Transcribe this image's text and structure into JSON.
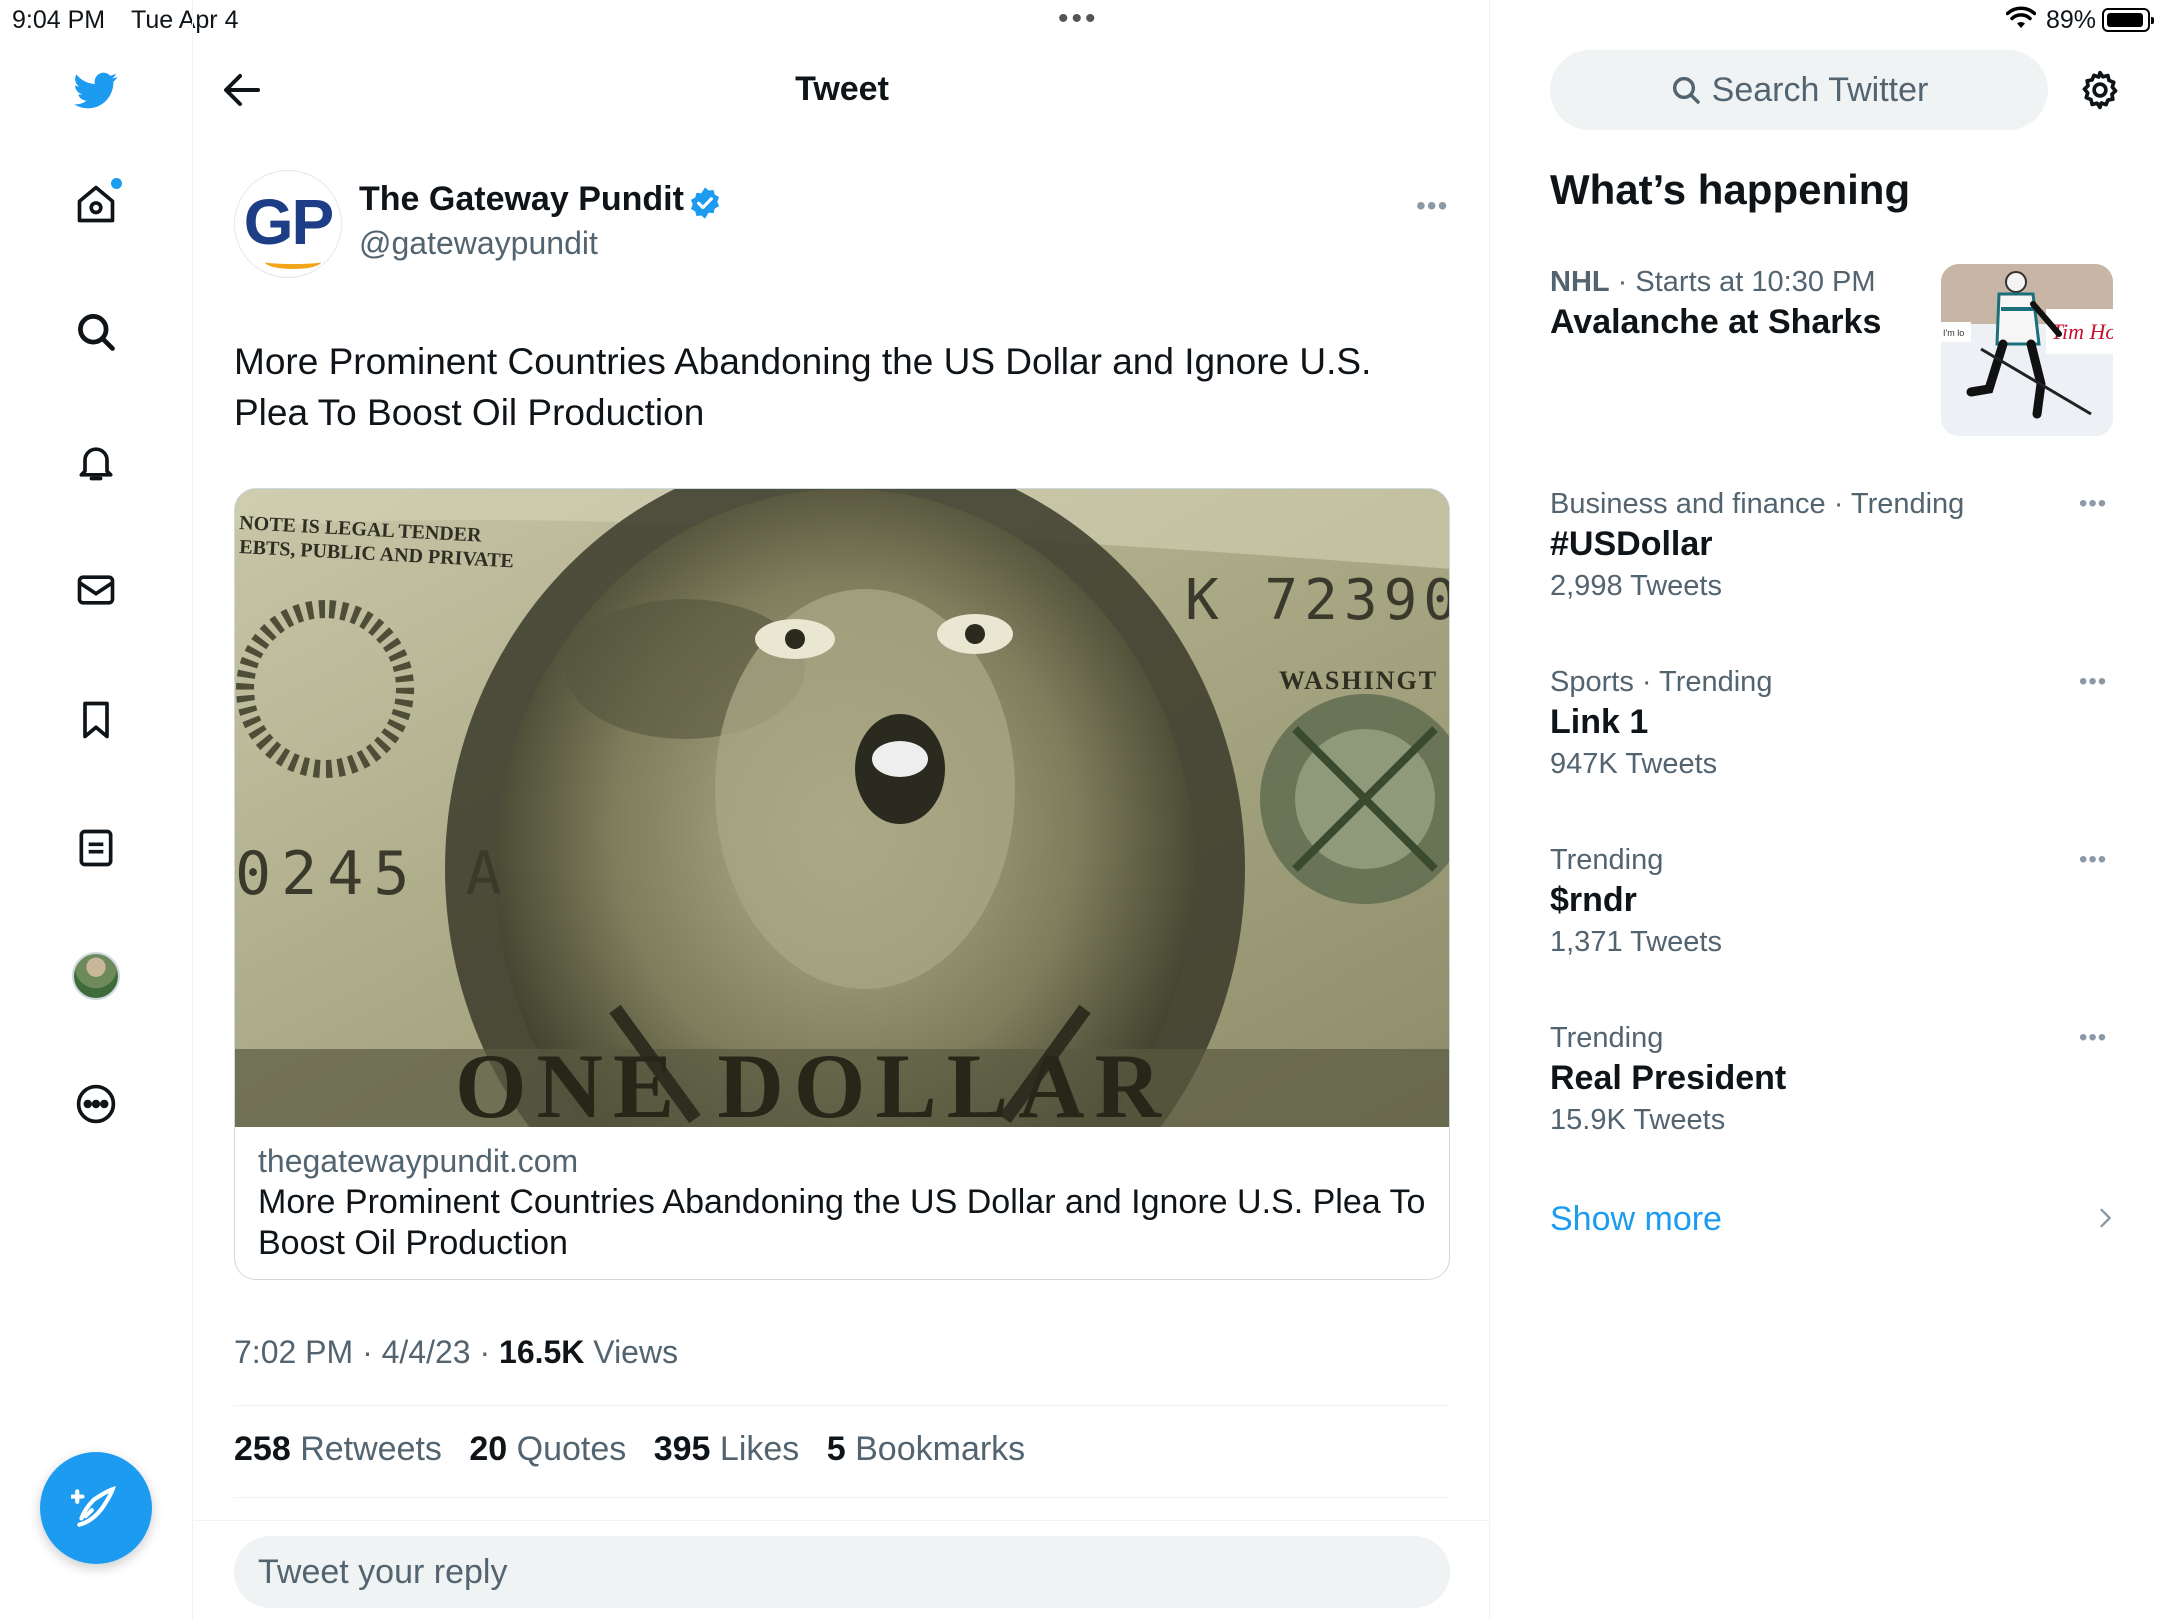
{
  "status_bar": {
    "time": "9:04 PM",
    "date": "Tue Apr 4",
    "battery": "89%",
    "battery_level": 0.89
  },
  "left_nav": {
    "items": [
      {
        "icon": "twitter-bird-icon"
      },
      {
        "icon": "home-icon"
      },
      {
        "icon": "search-icon"
      },
      {
        "icon": "bell-icon"
      },
      {
        "icon": "mail-icon"
      },
      {
        "icon": "bookmark-icon"
      },
      {
        "icon": "list-icon"
      },
      {
        "icon": "avatar"
      },
      {
        "icon": "more-circle-icon"
      }
    ],
    "compose_icon": "compose-feather-icon",
    "accent_color": "#1d9bf0"
  },
  "header": {
    "title": "Tweet"
  },
  "tweet": {
    "author_logo": "GP",
    "author_name": "The Gateway Pundit",
    "handle": "@gatewaypundit",
    "text": "More Prominent Countries Abandoning the US Dollar and Ignore U.S. Plea To Boost Oil Production",
    "card": {
      "domain": "thegatewaypundit.com",
      "title": "More Prominent Countries Abandoning the US Dollar and Ignore U.S. Plea To Boost Oil Production",
      "image_texts": {
        "legal": "NOTE IS LEGAL TENDER",
        "debts": "EBTS, PUBLIC AND PRIVATE",
        "serial_right": "K 72390",
        "serial_left": "0245 A",
        "washington": "WASHINGT",
        "one_dollar": "ONE DOLLAR"
      }
    },
    "time": "7:02 PM",
    "date": "4/4/23",
    "views_count": "16.5K",
    "views_label": "Views",
    "stats": {
      "retweets": "258",
      "retweets_label": "Retweets",
      "quotes": "20",
      "quotes_label": "Quotes",
      "likes": "395",
      "likes_label": "Likes",
      "bookmarks": "5",
      "bookmarks_label": "Bookmarks"
    },
    "reply_placeholder": "Tweet your reply"
  },
  "sidebar": {
    "search_placeholder": "Search Twitter",
    "whats_happening": "What’s happening",
    "trends": [
      {
        "category": "NHL",
        "context": " · Starts at 10:30 PM",
        "name": "Avalanche at Sharks",
        "count": ""
      },
      {
        "category": "Business and finance · Trending",
        "context": "",
        "name": "#USDollar",
        "count": "2,998 Tweets"
      },
      {
        "category": "Sports · Trending",
        "context": "",
        "name": "Link 1",
        "count": "947K Tweets"
      },
      {
        "category": "Trending",
        "context": "",
        "name": "$rndr",
        "count": "1,371 Tweets"
      },
      {
        "category": "Trending",
        "context": "",
        "name": "Real President",
        "count": "15.9K Tweets"
      }
    ],
    "thumb_texts": {
      "board": "I'm lo",
      "sponsor": "Tim Hor"
    },
    "show_more": "Show more"
  }
}
